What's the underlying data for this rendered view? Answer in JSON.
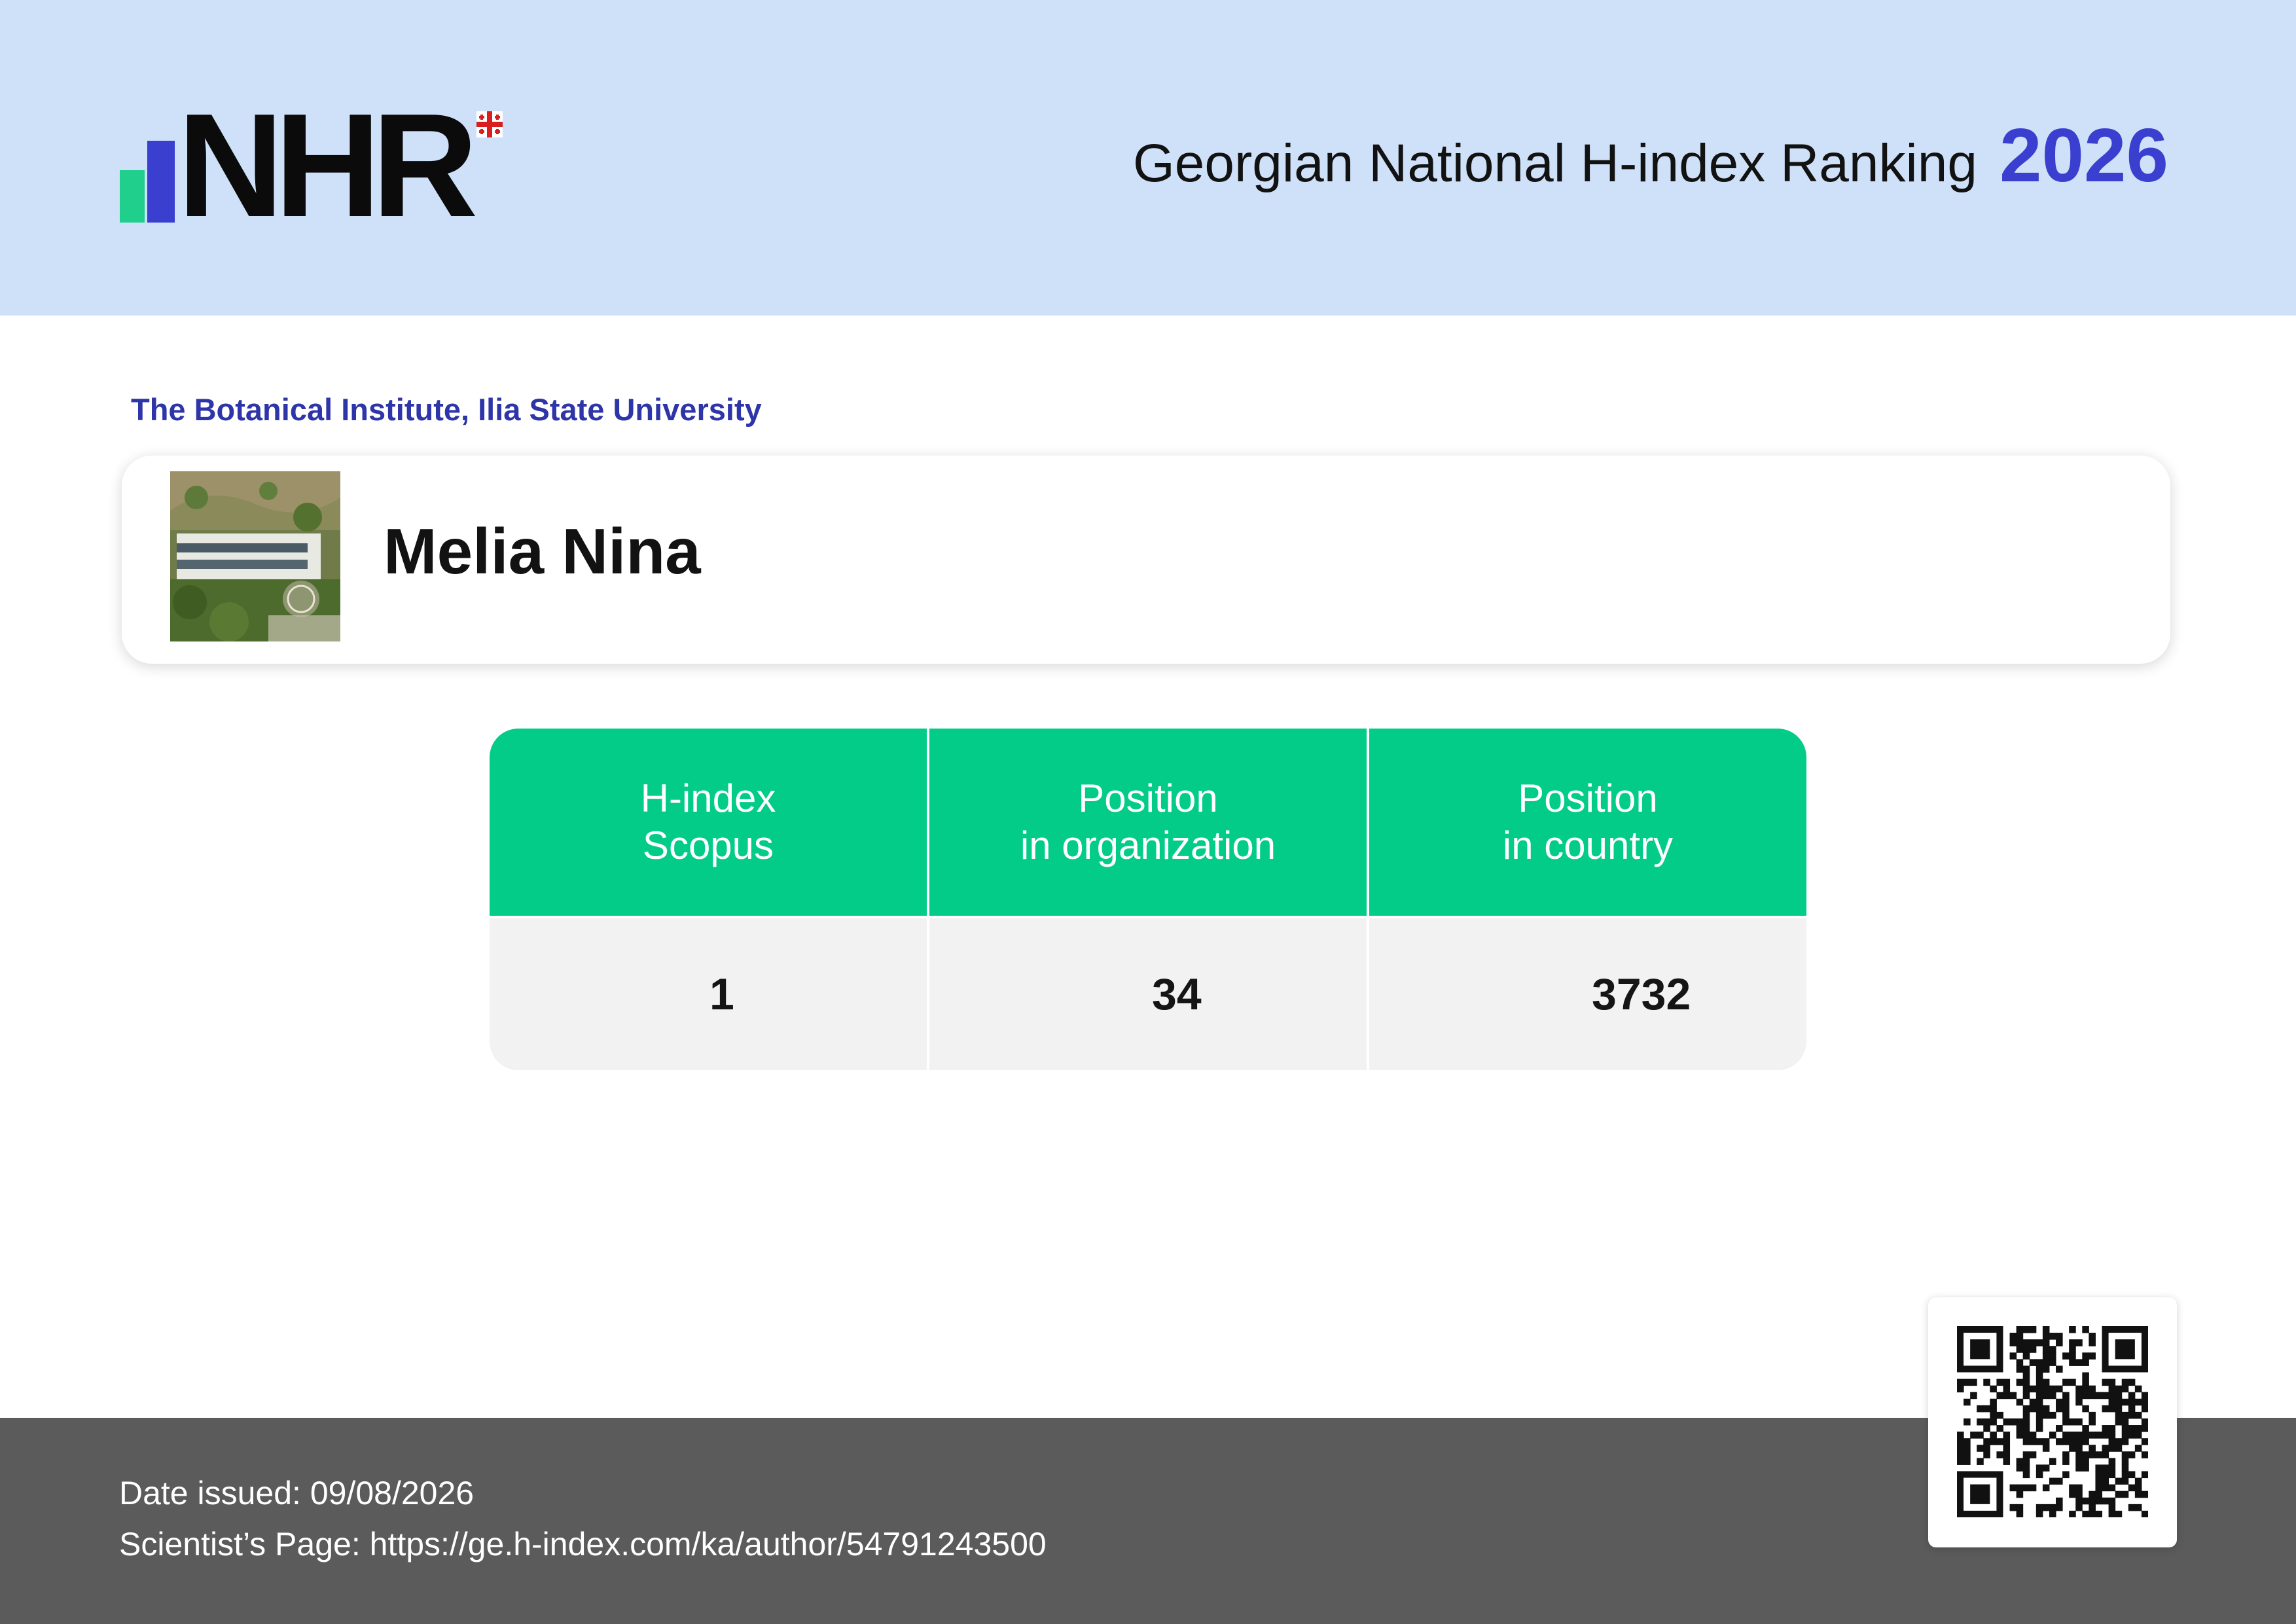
{
  "header": {
    "logo_text": "NHR",
    "title": "Georgian National H-index Ranking",
    "year": "2026"
  },
  "profile": {
    "organization": "The Botanical Institute, Ilia State University",
    "name": "Melia Nina"
  },
  "stats": {
    "hindex": {
      "label_line1": "H-index",
      "label_line2": "Scopus",
      "value": "1"
    },
    "org_position": {
      "label_line1": "Position",
      "label_line2": "in organization",
      "value": "34"
    },
    "country_position": {
      "label_line1": "Position",
      "label_line2": "in country",
      "value": "3732"
    }
  },
  "footer": {
    "date_label": "Date issued:",
    "date_value": "09/08/2026",
    "page_label": "Scientist’s Page:",
    "page_url": "https://ge.h-index.com/ka/author/54791243500"
  },
  "colors": {
    "header_bg": "#cfe1f8",
    "accent_blue": "#3a3fd0",
    "accent_green": "#02cc87",
    "footer_bg": "#5b5b5b"
  }
}
